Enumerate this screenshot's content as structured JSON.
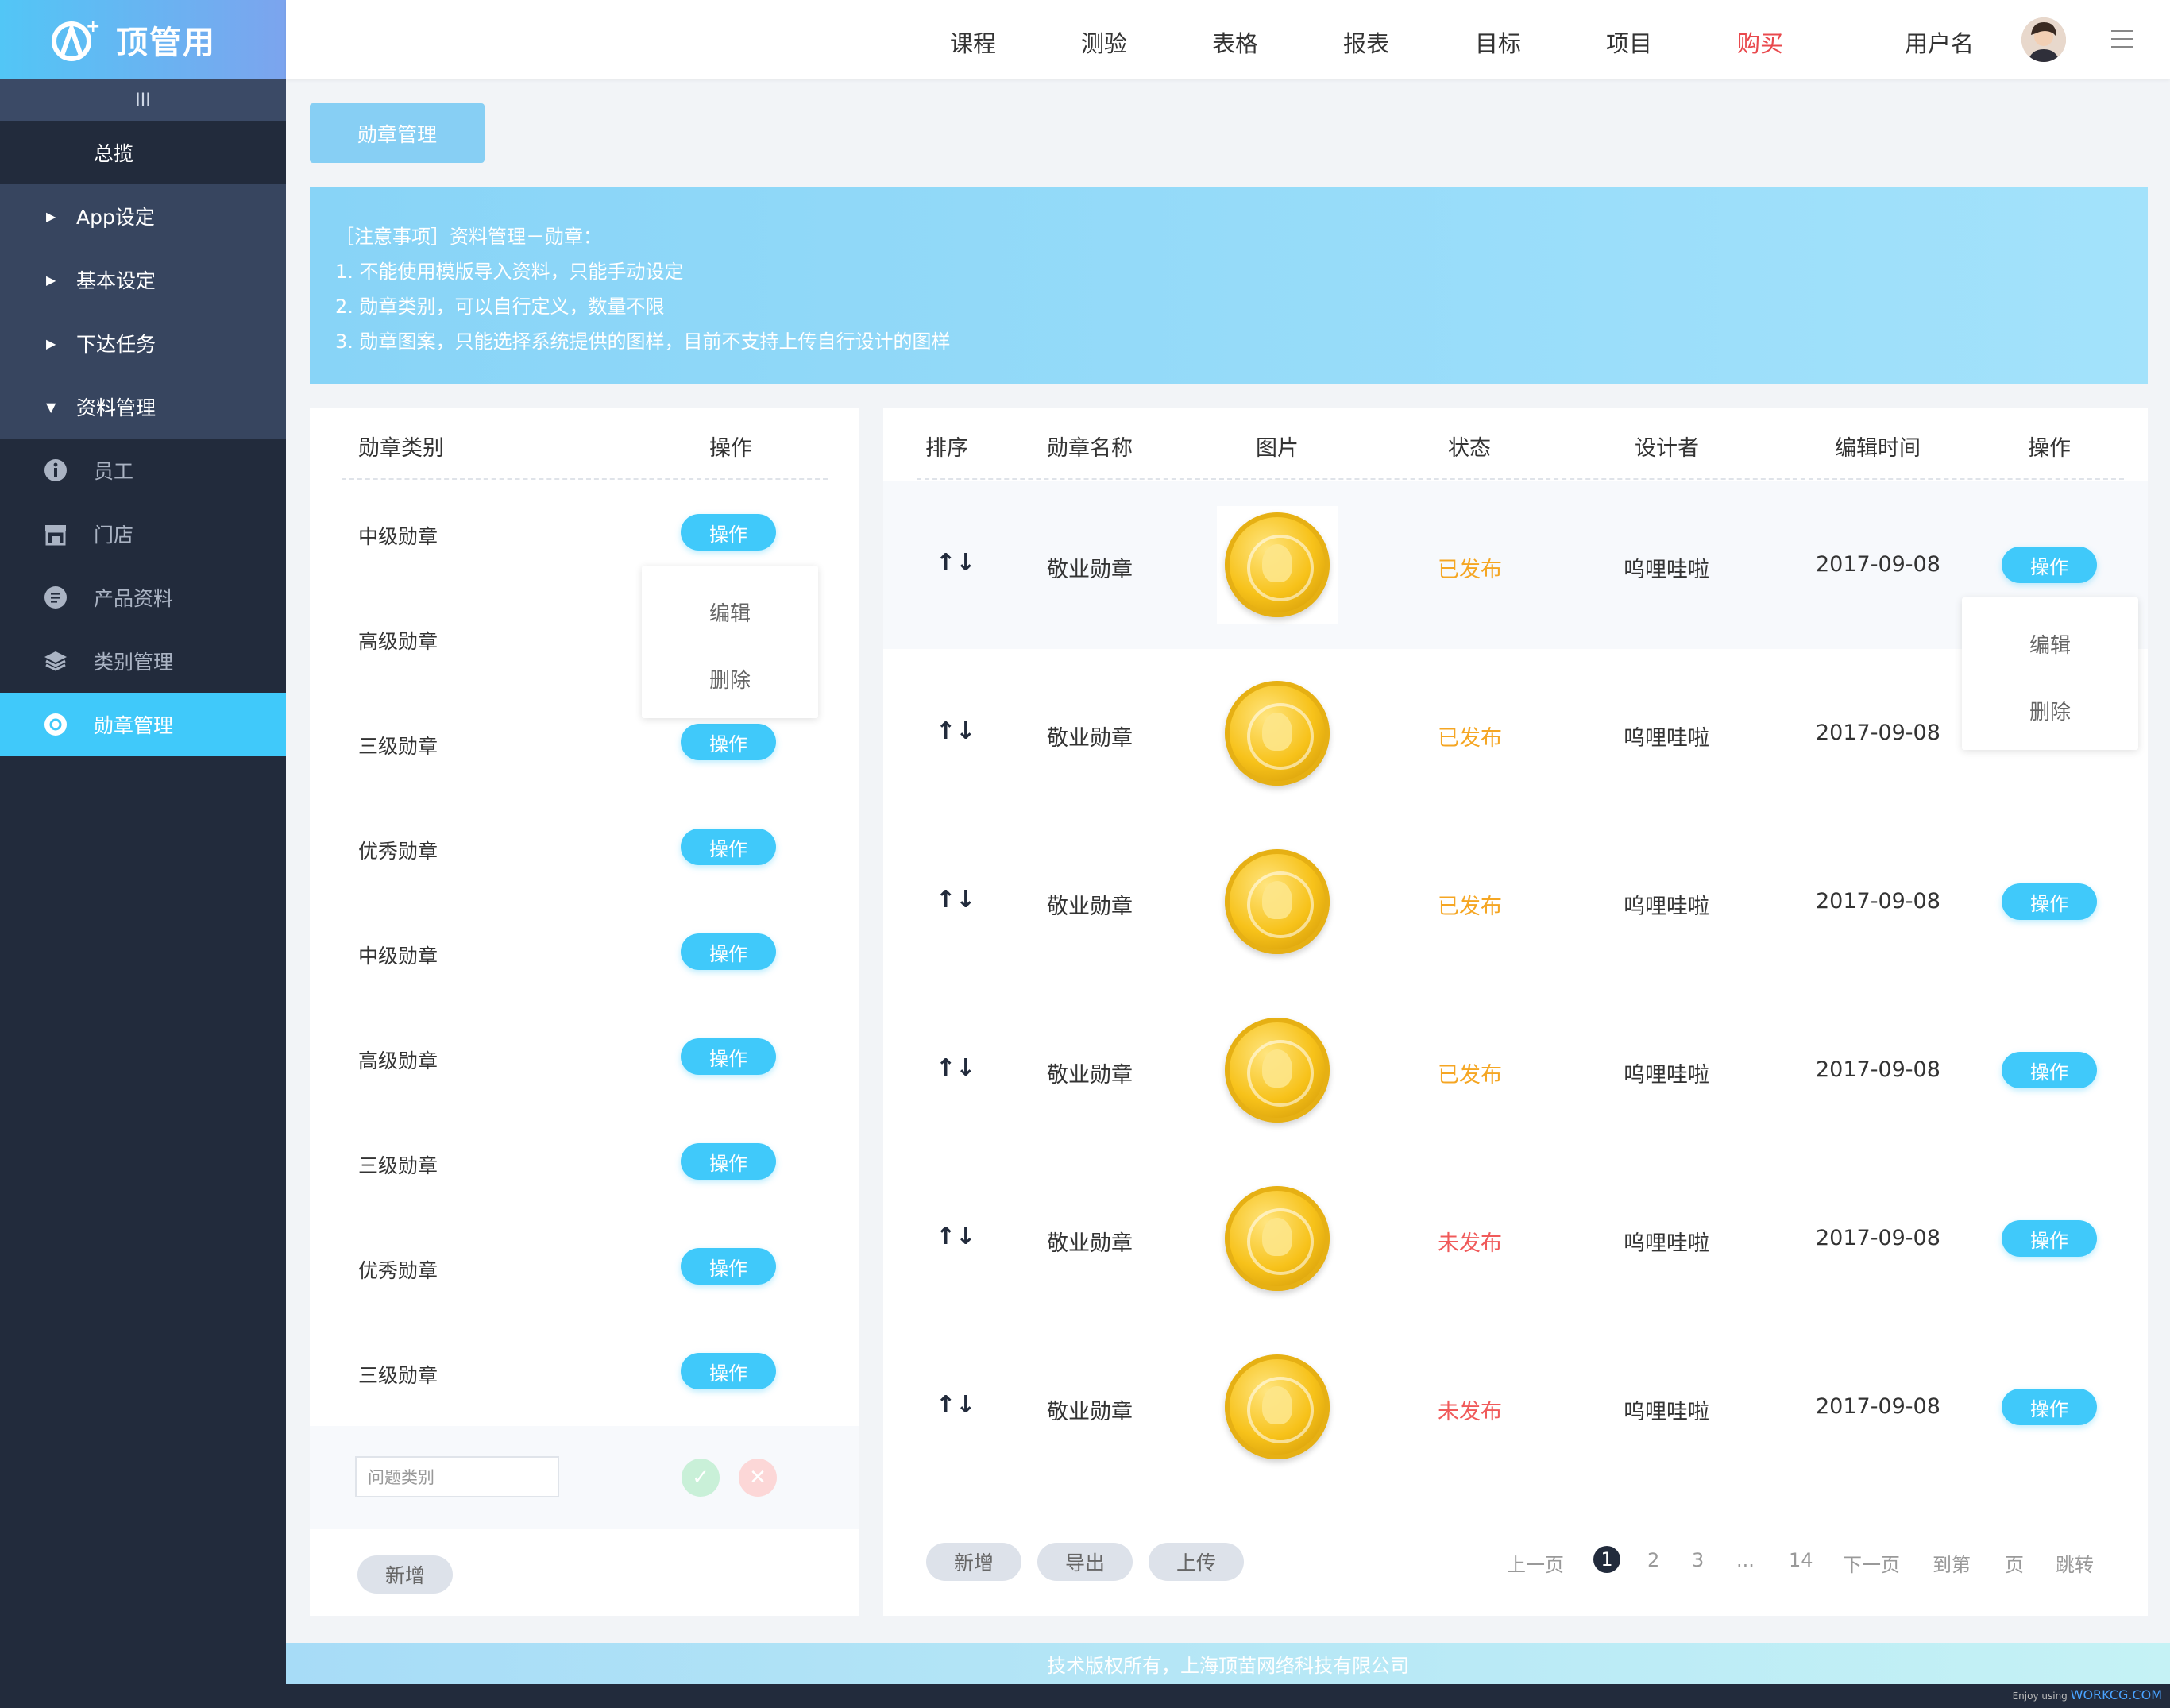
{
  "brand": {
    "name": "顶管用",
    "mark": "A",
    "plus": "+"
  },
  "sidebar": {
    "collapse_label": "III",
    "items": [
      {
        "label": "总揽"
      },
      {
        "label": "App设定"
      },
      {
        "label": "基本设定"
      },
      {
        "label": "下达任务"
      },
      {
        "label": "资料管理"
      },
      {
        "label": "员工",
        "icon": "info-icon"
      },
      {
        "label": "门店",
        "icon": "store-icon"
      },
      {
        "label": "产品资料",
        "icon": "document-icon"
      },
      {
        "label": "类别管理",
        "icon": "layers-icon"
      },
      {
        "label": "勋章管理",
        "icon": "medal-icon"
      }
    ]
  },
  "topnav": {
    "items": [
      "课程",
      "测验",
      "表格",
      "报表",
      "目标",
      "项目",
      "购买"
    ],
    "highlight_color": "#e9494d",
    "username": "用户名"
  },
  "page_button": "勋章管理",
  "notice": {
    "lines": [
      "［注意事项］资料管理－勋章：",
      "1. 不能使用模版导入资料，只能手动设定",
      "2. 勋章类别，可以自行定义，数量不限",
      "3. 勋章图案，只能选择系统提供的图样，目前不支持上传自行设计的图样"
    ]
  },
  "categories": {
    "headers": {
      "name": "勋章类别",
      "action": "操作"
    },
    "rows": [
      "中级勋章",
      "高级勋章",
      "三级勋章",
      "优秀勋章",
      "中级勋章",
      "高级勋章",
      "三级勋章",
      "优秀勋章",
      "三级勋章"
    ],
    "action_label": "操作",
    "dropdown": {
      "edit": "编辑",
      "delete": "删除"
    },
    "input_placeholder": "问题类别",
    "confirm_icon": "check-icon",
    "cancel_icon": "close-icon",
    "add_label": "新增"
  },
  "medals": {
    "headers": {
      "order": "排序",
      "name": "勋章名称",
      "image": "图片",
      "status": "状态",
      "designer": "设计者",
      "time": "编辑时间",
      "action": "操作"
    },
    "rows": [
      {
        "name": "敬业勋章",
        "status": "已发布",
        "designer": "呜哩哇啦",
        "time": "2017-09-08"
      },
      {
        "name": "敬业勋章",
        "status": "已发布",
        "designer": "呜哩哇啦",
        "time": "2017-09-08"
      },
      {
        "name": "敬业勋章",
        "status": "已发布",
        "designer": "呜哩哇啦",
        "time": "2017-09-08"
      },
      {
        "name": "敬业勋章",
        "status": "已发布",
        "designer": "呜哩哇啦",
        "time": "2017-09-08"
      },
      {
        "name": "敬业勋章",
        "status": "未发布",
        "designer": "呜哩哇啦",
        "time": "2017-09-08"
      },
      {
        "name": "敬业勋章",
        "status": "未发布",
        "designer": "呜哩哇啦",
        "time": "2017-09-08"
      }
    ],
    "sort_glyph": "↑↓",
    "action_label": "操作",
    "dropdown": {
      "edit": "编辑",
      "delete": "删除"
    },
    "status_colors": {
      "published": "#f5a623",
      "unpublished": "#f05a5a"
    },
    "buttons": {
      "add": "新增",
      "export": "导出",
      "upload": "上传"
    }
  },
  "pagination": {
    "prev": "上一页",
    "current": "1",
    "pages": [
      "2",
      "3"
    ],
    "ellipsis": "...",
    "last": "14",
    "next": "下一页",
    "goto": "到第",
    "page_unit": "页",
    "jump": "跳转"
  },
  "footer": "技术版权所有，上海顶苗网络科技有限公司",
  "credit": {
    "prefix": "Enjoy using",
    "site": "WORKCG.COM"
  }
}
